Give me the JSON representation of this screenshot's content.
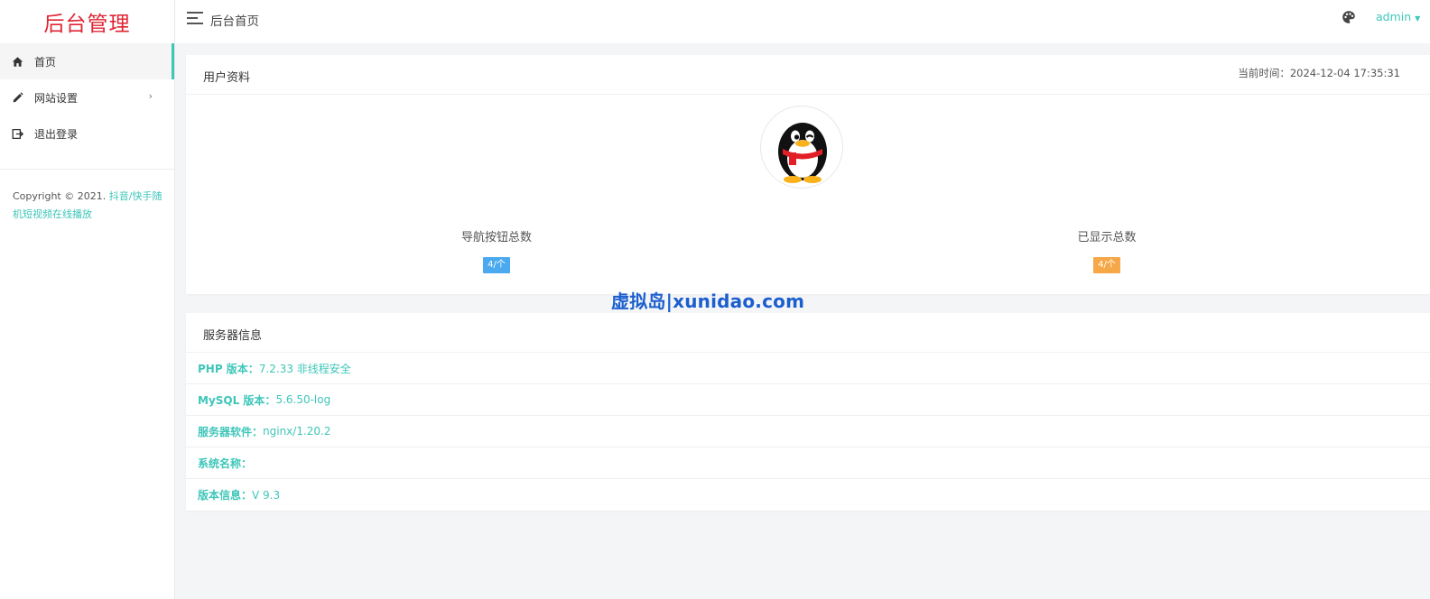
{
  "brand": {
    "title": "后台管理"
  },
  "colors": {
    "accent": "#3ec6b9",
    "brand_red": "#e02433",
    "badge_blue": "#4aa9ef",
    "badge_orange": "#f6a747"
  },
  "sidebar": {
    "items": [
      {
        "label": "首页",
        "icon": "home-icon",
        "active": true
      },
      {
        "label": "网站设置",
        "icon": "pencil-icon",
        "has_submenu": true
      },
      {
        "label": "退出登录",
        "icon": "logout-icon"
      }
    ],
    "submenu_arrow": "›",
    "copyright_prefix": "Copyright © 2021. ",
    "copyright_link": "抖音/快手随机短视频在线播放"
  },
  "topbar": {
    "title": "后台首页",
    "user": "admin",
    "caret": "▼"
  },
  "profile_card": {
    "title": "用户资料",
    "time_label": "当前时间：",
    "time_value": "2024-12-04 17:35:31",
    "stats": [
      {
        "label": "导航按钮总数",
        "badge": "4/个",
        "color": "blue"
      },
      {
        "label": "已显示总数",
        "badge": "4/个",
        "color": "orange"
      }
    ]
  },
  "server_card": {
    "title": "服务器信息",
    "rows": [
      {
        "label": "PHP 版本：",
        "value": "7.2.33 非线程安全"
      },
      {
        "label": "MySQL 版本：",
        "value": "5.6.50-log"
      },
      {
        "label": "服务器软件：",
        "value": "nginx/1.20.2"
      },
      {
        "label": "系统名称：",
        "value": ""
      },
      {
        "label": "版本信息：",
        "value": "V 9.3"
      }
    ]
  },
  "watermark": {
    "text": "虚拟岛|xunidao.com"
  }
}
